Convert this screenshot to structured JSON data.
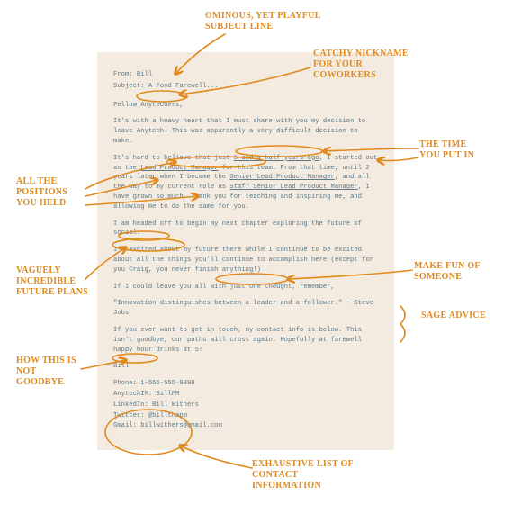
{
  "email": {
    "from_label": "From:",
    "from_value": "Bill",
    "subject_label": "Subject:",
    "subject_value": "A Fond Farewell...",
    "salutation": "Fellow Anytechers,",
    "para1": "It's with a heavy heart that I must share with you my decision to leave Anytech. This was apparently a very difficult decision to make.",
    "para2_a": "It's hard to believe that just ",
    "para2_time": "5 and a half years ago",
    "para2_b": ", I started out as the ",
    "para2_role1": "Lead Product Manager",
    "para2_c": " for this team. From that time, until 2 years later when I became the ",
    "para2_role2": "Senior Lead Product Manager",
    "para2_d": ", and all the way to my current role as ",
    "para2_role3": "Staff Senior Lead Product Manager",
    "para2_e": ", I have grown so much. Thank you for teaching and inspiring me, and allowing me to do the same for you.",
    "para3_a": "I am headed off to begin my next chapter exploring the ",
    "para3_future": "future of social.",
    "para4": "I'm excited about my future there while I continue to be excited about all the things you'll continue to accomplish here (except for you Craig, you never finish anything!)",
    "para5": "If I could leave you all with just one thought, remember,",
    "quote": "\"Innovation distinguishes between a leader and a follower.\" - Steve Jobs",
    "para6": "If you ever want to get in touch, my contact info is below. This isn't goodbye, our paths will cross again. Hopefully at farewell happy hour drinks at 5!",
    "signoff": "Bill",
    "contact": {
      "phone": "Phone: 1-555-555-9898",
      "im": "AnytechIM: BillPM",
      "linkedin": "LinkedIn: Bill Withers",
      "twitter": "Twitter: @billthepm",
      "gmail": "Gmail: billwithers@gmail.com"
    }
  },
  "annotations": {
    "subject": "OMINOUS, YET PLAYFUL SUBJECT LINE",
    "nickname": "CATCHY NICKNAME FOR YOUR COWORKERS",
    "time": "THE TIME YOU PUT IN",
    "positions": "ALL THE POSITIONS YOU HELD",
    "future": "VAGUELY INCREDIBLE FUTURE PLANS",
    "makefun": "MAKE FUN OF SOMEONE",
    "sage": "SAGE ADVICE",
    "notgoodbye": "HOW THIS IS NOT GOODBYE",
    "contact": "EXHAUSTIVE LIST OF CONTACT INFORMATION"
  }
}
